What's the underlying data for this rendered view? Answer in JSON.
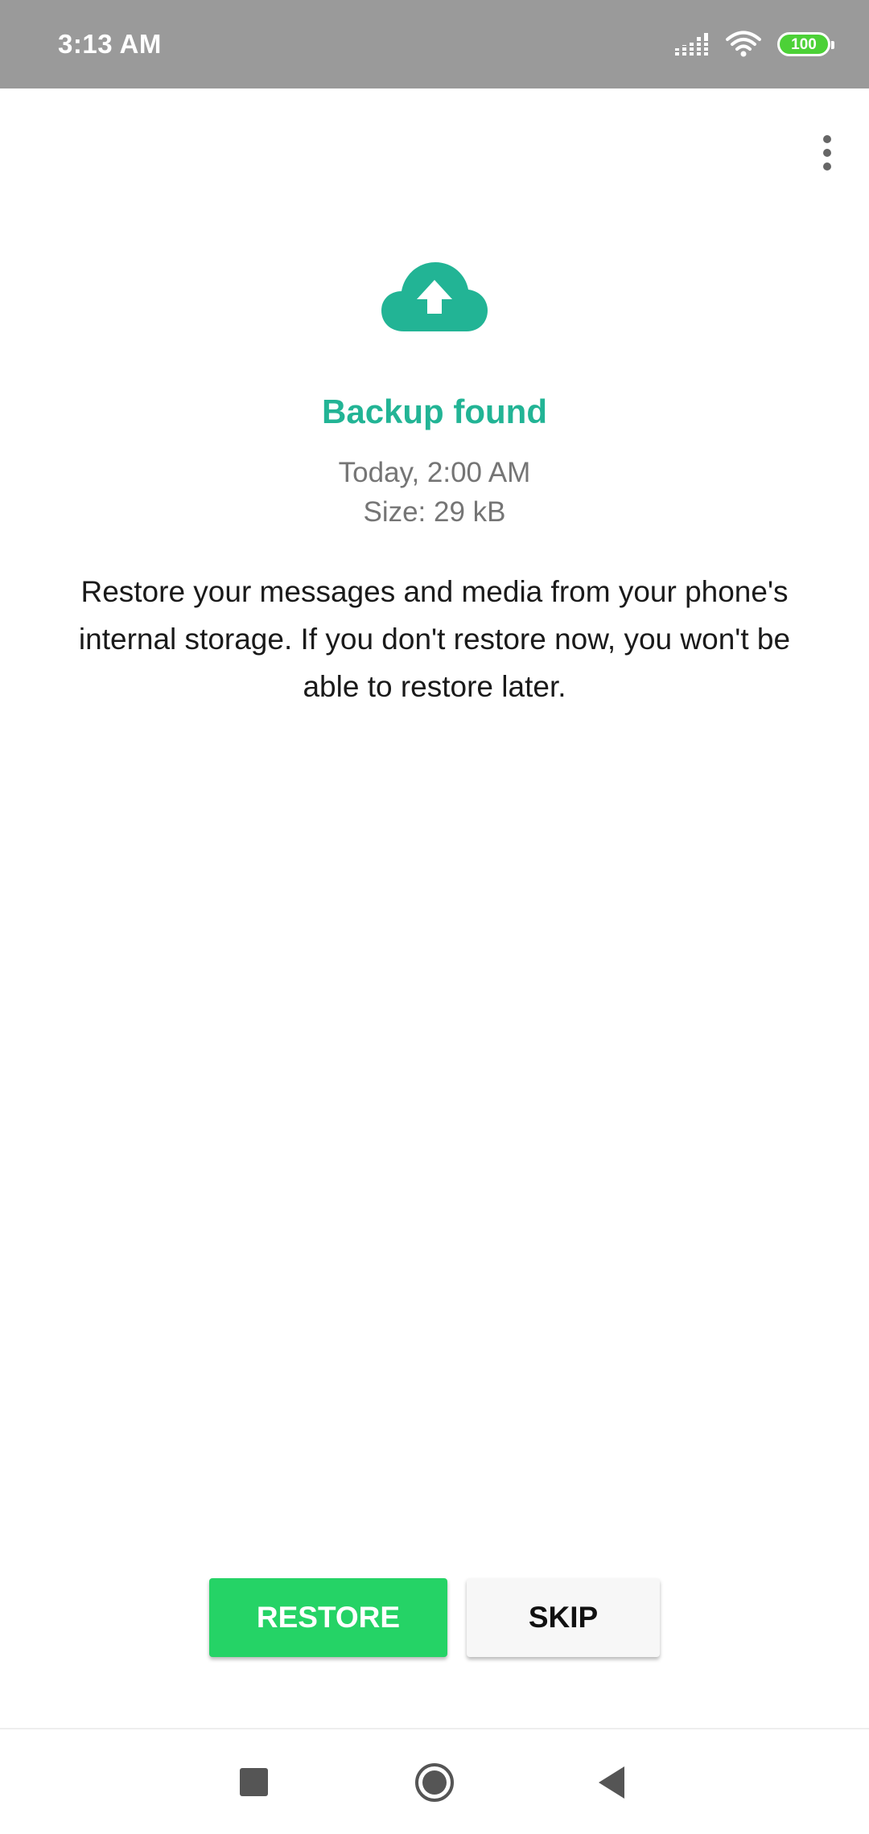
{
  "status_bar": {
    "time": "3:13 AM",
    "battery_level": "100",
    "icons": [
      "signal-icon",
      "wifi-icon",
      "battery-icon"
    ]
  },
  "menu": {
    "icon": "more-vert-icon"
  },
  "backup": {
    "icon": "cloud-upload-icon",
    "title": "Backup found",
    "date": "Today, 2:00 AM",
    "size": "Size: 29 kB",
    "description": "Restore your messages and media from your phone's internal storage. If you don't restore now, you won't be able to restore later."
  },
  "actions": {
    "restore_label": "RESTORE",
    "skip_label": "SKIP"
  },
  "nav_bar": {
    "icons": [
      "recent-apps-icon",
      "home-icon",
      "back-icon"
    ]
  },
  "colors": {
    "accent": "#22b495",
    "restore_button": "#25d366",
    "status_bar": "#9a9a9a",
    "battery": "#4cd137"
  }
}
